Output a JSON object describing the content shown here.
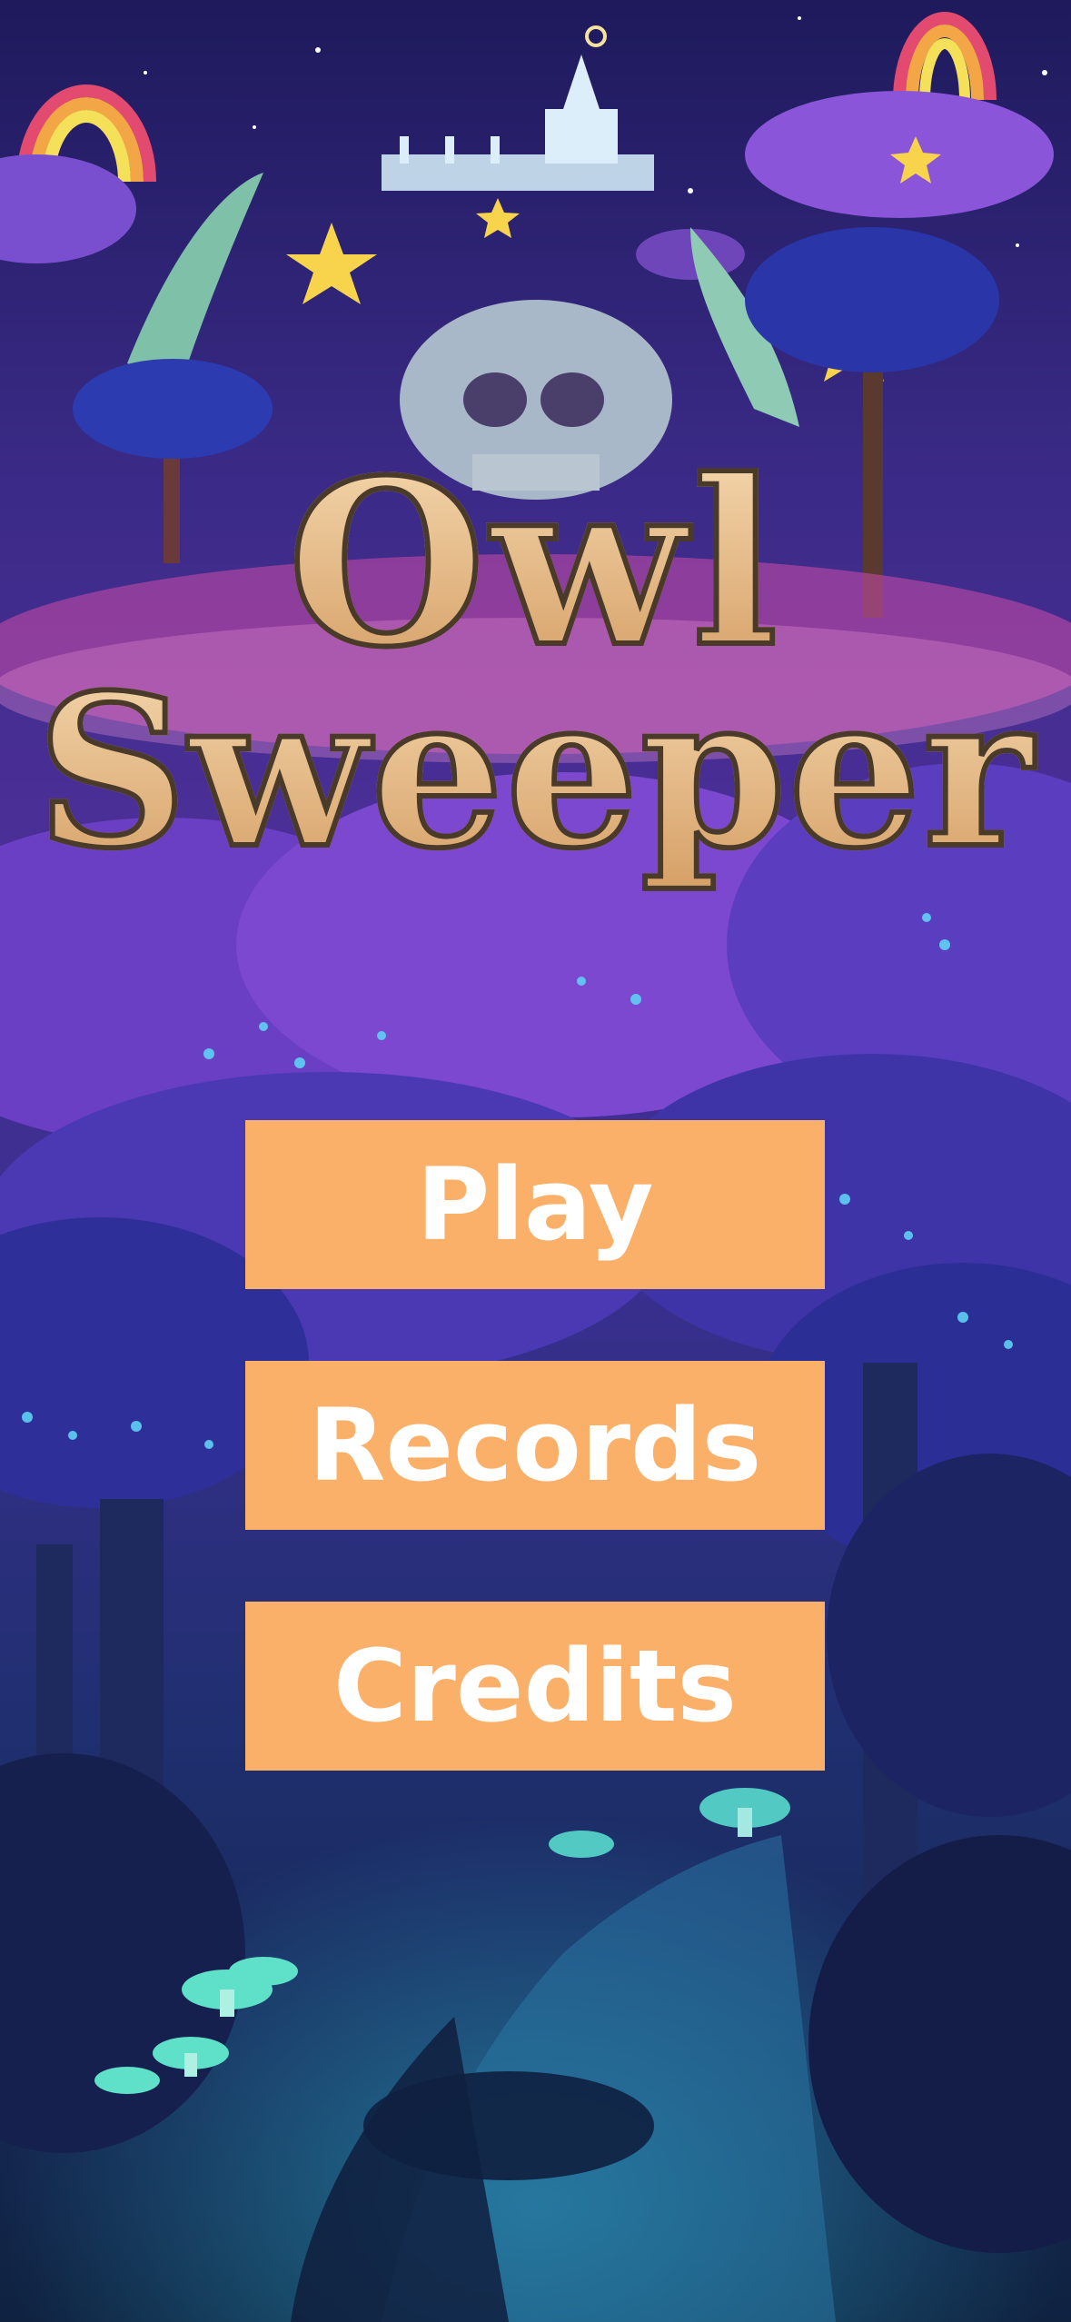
{
  "game": {
    "title_line1": "Owl",
    "title_line2": "Sweeper"
  },
  "menu": {
    "play_label": "Play",
    "records_label": "Records",
    "credits_label": "Credits",
    "button_color": "#fbb06a",
    "text_color": "#ffffff"
  },
  "icons": [
    "rainbow-icon",
    "star-icon",
    "crown-castle-icon",
    "skull-icon",
    "tree-icon",
    "mushroom-icon"
  ]
}
